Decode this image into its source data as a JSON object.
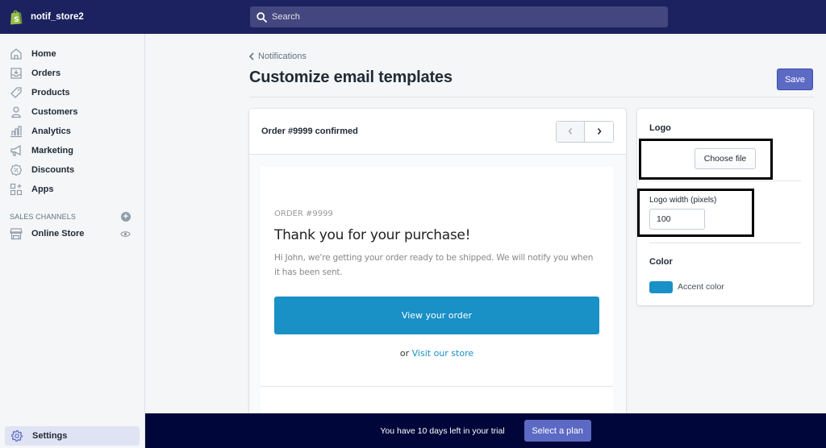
{
  "topbar": {
    "store_name": "notif_store2",
    "logo_icon": "shopify-bag-icon",
    "search": {
      "placeholder": "Search",
      "value": "",
      "icon": "search-icon"
    }
  },
  "sidebar": {
    "items": [
      {
        "label": "Home",
        "icon": "home-icon"
      },
      {
        "label": "Orders",
        "icon": "orders-inbox-icon"
      },
      {
        "label": "Products",
        "icon": "tag-icon"
      },
      {
        "label": "Customers",
        "icon": "person-icon"
      },
      {
        "label": "Analytics",
        "icon": "bar-chart-icon"
      },
      {
        "label": "Marketing",
        "icon": "megaphone-icon"
      },
      {
        "label": "Discounts",
        "icon": "discount-badge-icon"
      },
      {
        "label": "Apps",
        "icon": "apps-grid-icon"
      }
    ],
    "sales_channels": {
      "title": "SALES CHANNELS",
      "add_icon": "plus-circle-icon",
      "items": [
        {
          "label": "Online Store",
          "icon": "storefront-icon",
          "action_icon": "eye-icon"
        }
      ]
    },
    "settings": {
      "label": "Settings",
      "icon": "gear-icon"
    }
  },
  "page": {
    "breadcrumb": "Notifications",
    "title": "Customize email templates",
    "save_label": "Save"
  },
  "preview": {
    "title": "Order #9999 confirmed",
    "prev_icon": "chevron-left-icon",
    "next_icon": "chevron-right-icon",
    "email": {
      "order_label": "ORDER #9999",
      "heading": "Thank you for your purchase!",
      "body": "Hi John, we're getting your order ready to be shipped. We will notify you when it has been sent.",
      "cta_label": "View your order",
      "alt_prefix": "or",
      "alt_link": "Visit our store"
    }
  },
  "settings_panel": {
    "logo_label": "Logo",
    "choose_file_label": "Choose file",
    "logo_width_label": "Logo width (pixels)",
    "logo_width_value": "100",
    "color_label": "Color",
    "accent_label": "Accent color",
    "accent_color": "#1990c6"
  },
  "trial": {
    "message": "You have 10 days left in your trial",
    "button_label": "Select a plan"
  },
  "colors": {
    "topbar": "#1c2260",
    "search_bg": "#43467f",
    "primary": "#5c6ac4",
    "trial_bar": "#000639",
    "accent": "#1990c6"
  }
}
